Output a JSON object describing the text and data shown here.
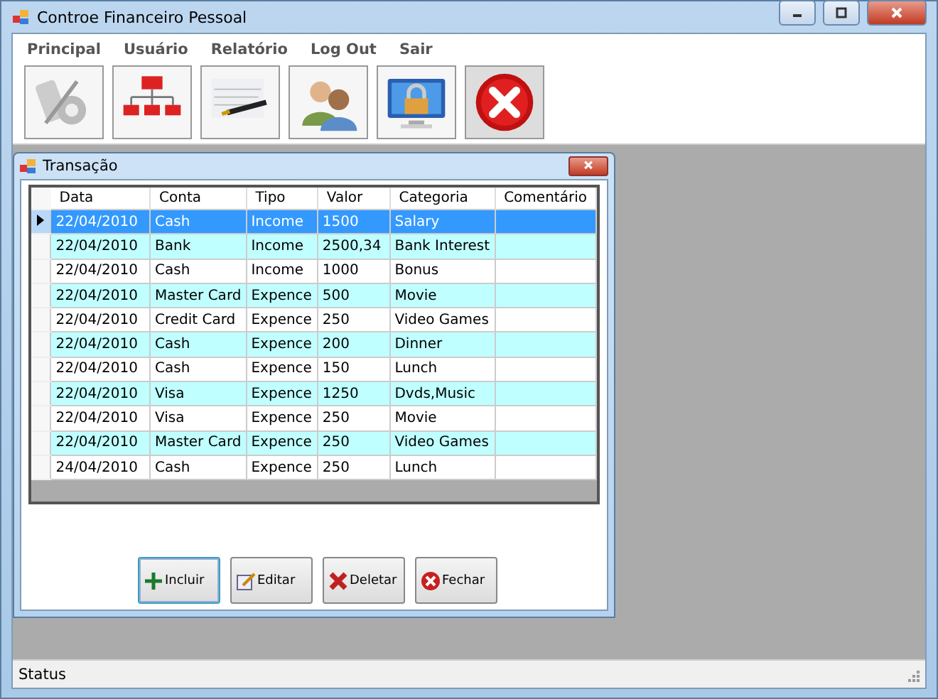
{
  "window": {
    "title": "Controe Financeiro Pessoal"
  },
  "menu": [
    "Principal",
    "Usuário",
    "Relatório",
    "Log Out",
    "Sair"
  ],
  "toolbar": [
    {
      "kind": "percent"
    },
    {
      "kind": "hierarchy"
    },
    {
      "kind": "pen"
    },
    {
      "kind": "users"
    },
    {
      "kind": "lock"
    },
    {
      "kind": "close"
    }
  ],
  "child_window": {
    "title": "Transação"
  },
  "table": {
    "columns": [
      "Data",
      "Conta",
      "Tipo",
      "Valor",
      "Categoria",
      "Comentário"
    ],
    "rows": [
      {
        "selected": true,
        "cells": [
          "22/04/2010",
          "Cash",
          "Income",
          "1500",
          "Salary"
        ]
      },
      {
        "selected": false,
        "cells": [
          "22/04/2010",
          "Bank",
          "Income",
          "2500,34",
          "Bank Interest"
        ]
      },
      {
        "selected": false,
        "cells": [
          "22/04/2010",
          "Cash",
          "Income",
          "1000",
          "Bonus"
        ]
      },
      {
        "selected": false,
        "cells": [
          "22/04/2010",
          "Master Card",
          "Expence",
          "500",
          "Movie"
        ]
      },
      {
        "selected": false,
        "cells": [
          "22/04/2010",
          "Credit Card",
          "Expence",
          "250",
          "Video Games"
        ]
      },
      {
        "selected": false,
        "cells": [
          "22/04/2010",
          "Cash",
          "Expence",
          "200",
          "Dinner"
        ]
      },
      {
        "selected": false,
        "cells": [
          "22/04/2010",
          "Cash",
          "Expence",
          "150",
          "Lunch"
        ]
      },
      {
        "selected": false,
        "cells": [
          "22/04/2010",
          "Visa",
          "Expence",
          "1250",
          "Dvds,Music"
        ]
      },
      {
        "selected": false,
        "cells": [
          "22/04/2010",
          "Visa",
          "Expence",
          "250",
          "Movie"
        ]
      },
      {
        "selected": false,
        "cells": [
          "22/04/2010",
          "Master Card",
          "Expence",
          "250",
          "Video Games"
        ]
      },
      {
        "selected": false,
        "cells": [
          "24/04/2010",
          "Cash",
          "Expence",
          "250",
          "Lunch"
        ]
      }
    ]
  },
  "buttons": [
    {
      "kind": "add",
      "label": "Incluir"
    },
    {
      "kind": "edit",
      "label": "Editar"
    },
    {
      "kind": "delete",
      "label": "Deletar"
    },
    {
      "kind": "close",
      "label": "Fechar"
    }
  ],
  "status_bar": "Status"
}
